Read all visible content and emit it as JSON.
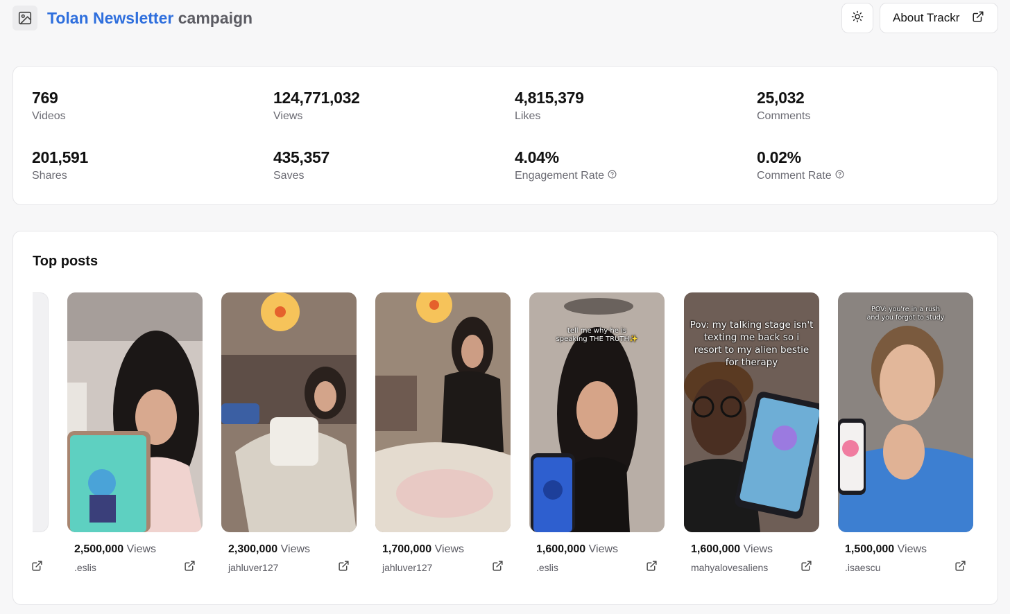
{
  "header": {
    "brand": "Tolan Newsletter",
    "title_rest": "campaign",
    "about_label": "About Trackr"
  },
  "stats": [
    {
      "value": "769",
      "label": "Videos"
    },
    {
      "value": "124,771,032",
      "label": "Views"
    },
    {
      "value": "4,815,379",
      "label": "Likes"
    },
    {
      "value": "25,032",
      "label": "Comments"
    },
    {
      "value": "201,591",
      "label": "Shares"
    },
    {
      "value": "435,357",
      "label": "Saves"
    },
    {
      "value": "4.04%",
      "label": "Engagement Rate"
    },
    {
      "value": "0.02%",
      "label": "Comment Rate"
    }
  ],
  "top_posts": {
    "title": "Top posts",
    "views_unit": "Views",
    "posts": [
      {
        "views": "2,500,000",
        "user": ".eslis",
        "caption": ""
      },
      {
        "views": "2,300,000",
        "user": "jahluver127",
        "caption": ""
      },
      {
        "views": "1,700,000",
        "user": "jahluver127",
        "caption": ""
      },
      {
        "views": "1,600,000",
        "user": ".eslis",
        "caption": "tell me why he is speaking THE TRUTH✨"
      },
      {
        "views": "1,600,000",
        "user": "mahyalovesaliens",
        "caption": "Pov: my talking stage isn't texting me back so i resort to my alien bestie for therapy"
      },
      {
        "views": "1,500,000",
        "user": ".isaescu",
        "caption": "POV: you're in a rush and you forgot to study"
      }
    ]
  },
  "colors": {
    "brand": "#2f6fdd",
    "page_bg": "#f7f7f8",
    "card_bg": "#ffffff"
  }
}
